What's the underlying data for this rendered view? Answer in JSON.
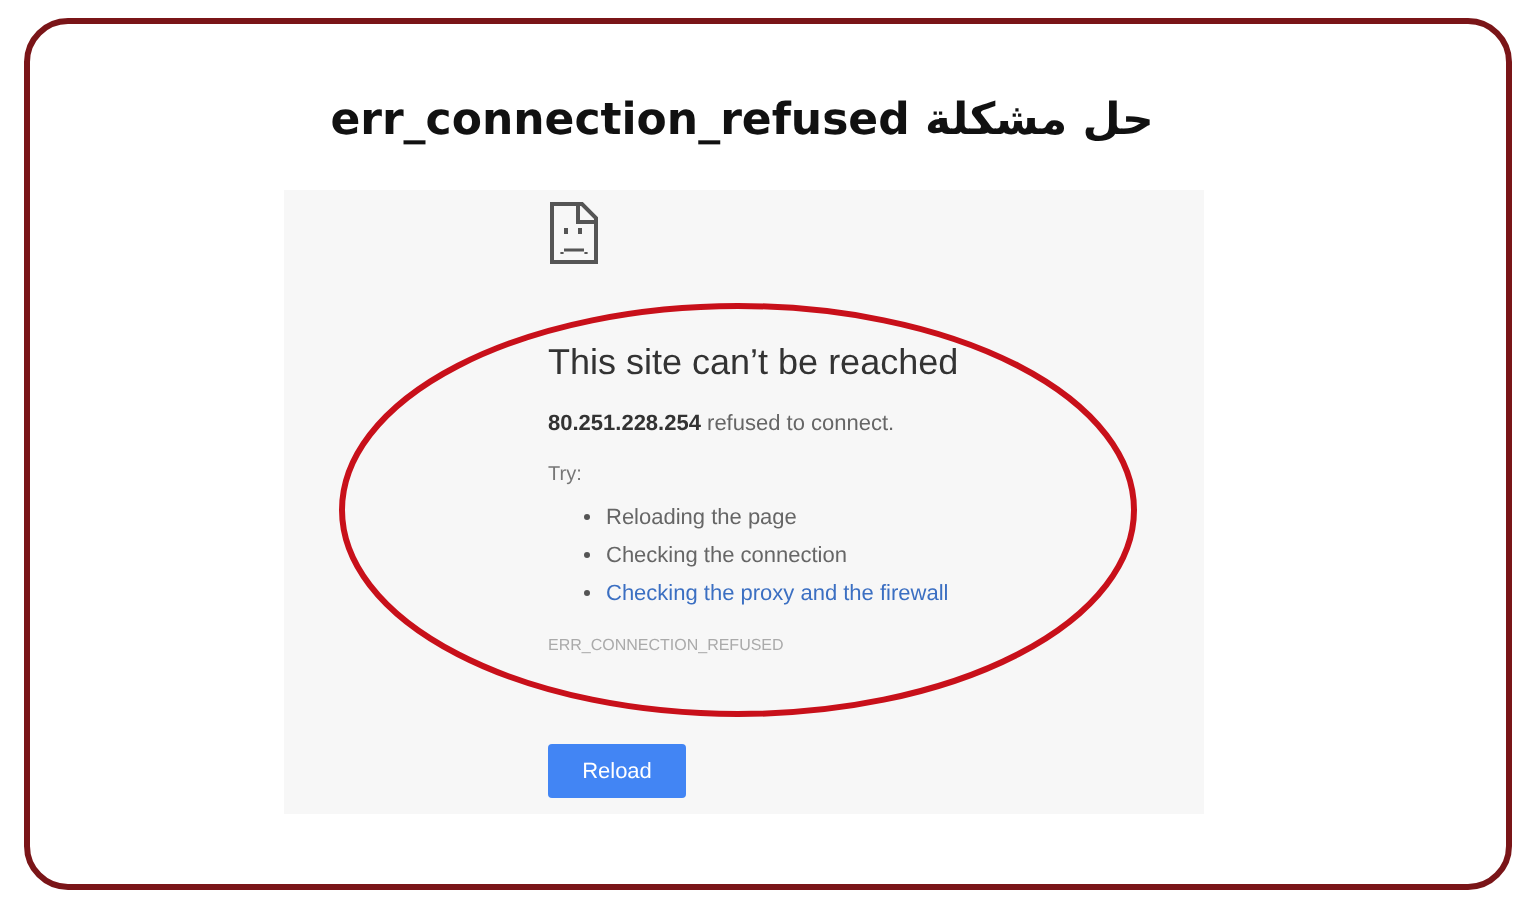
{
  "title": "حل مشكلة err_connection_refused",
  "error_page": {
    "heading": "This site can’t be reached",
    "message": "**80.251.228.254** refused to connect.",
    "try_label": "Try:",
    "suggestions": [
      {
        "kind": "text",
        "label": "Reloading the page"
      },
      {
        "kind": "text",
        "label": "Checking the connection"
      },
      {
        "kind": "link",
        "label": "Checking the proxy and the firewall"
      }
    ],
    "error_code": "ERR_CONNECTION_REFUSED",
    "button": "Reload"
  }
}
